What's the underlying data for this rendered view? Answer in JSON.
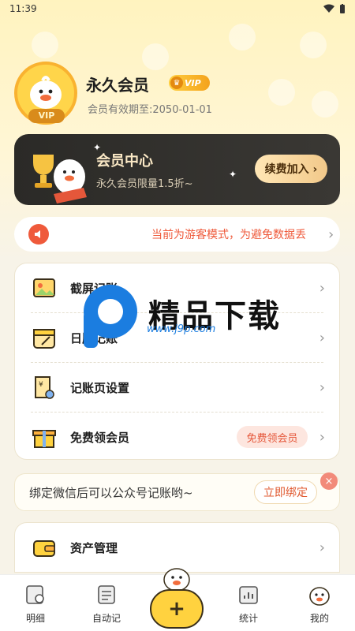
{
  "status_bar": {
    "time": "11:39"
  },
  "profile": {
    "name": "永久会员",
    "vip_badge": "VIP",
    "avatar_badge": "VIP",
    "expire_text": "会员有效期至:2050-01-01"
  },
  "member_card": {
    "title": "会员中心",
    "subtitle": "永久会员限量1.5折~",
    "button_label": "续费加入 ›"
  },
  "notice": {
    "text": "当前为游客模式，为避免数据丢"
  },
  "menu": {
    "items": [
      {
        "label": "截屏记账",
        "icon": "screenshot-icon"
      },
      {
        "label": "日历记账",
        "icon": "calendar-icon"
      },
      {
        "label": "记账页设置",
        "icon": "ledger-settings-icon"
      },
      {
        "label": "免费领会员",
        "icon": "gift-icon",
        "tag": "免费领会员"
      }
    ]
  },
  "watermark": {
    "title": "精品下载",
    "url": "www.j9p.com"
  },
  "bind_card": {
    "text": "绑定微信后可以公众号记账哟~",
    "button_label": "立即绑定"
  },
  "asset": {
    "label": "资产管理"
  },
  "bottom_nav": {
    "items": [
      {
        "label": "明细"
      },
      {
        "label": "自动记"
      },
      {
        "label": "统计"
      },
      {
        "label": "我的"
      }
    ],
    "add_label": "+"
  },
  "colors": {
    "accent_red": "#ef5a3b",
    "gold": "#ffd23f",
    "card_dark": "#2b2a27"
  }
}
